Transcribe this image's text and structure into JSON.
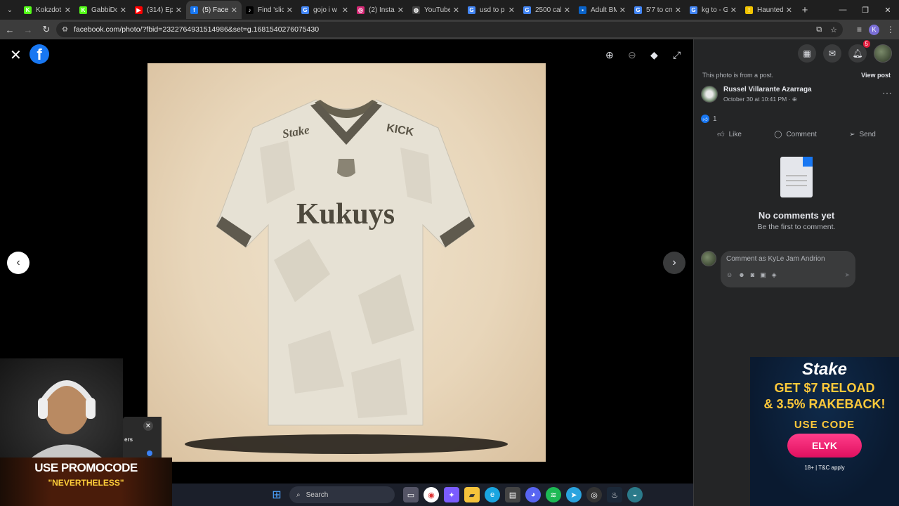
{
  "browser": {
    "tabs": [
      {
        "label": "Kokzdot",
        "color": "#53fc18",
        "glyph": "K",
        "active": false
      },
      {
        "label": "GabbiDo",
        "color": "#53fc18",
        "glyph": "K",
        "active": false
      },
      {
        "label": "(314) Ep",
        "color": "#ff0000",
        "glyph": "▶",
        "active": false
      },
      {
        "label": "(5) Faceb",
        "color": "#1877f2",
        "glyph": "f",
        "active": true
      },
      {
        "label": "Find 'slic",
        "color": "#000000",
        "glyph": "♪",
        "active": false
      },
      {
        "label": "gojo i w",
        "color": "#4285f4",
        "glyph": "G",
        "active": false
      },
      {
        "label": "(2) Insta",
        "color": "#d62976",
        "glyph": "◎",
        "active": false
      },
      {
        "label": "YouTube",
        "color": "#444444",
        "glyph": "◍",
        "active": false
      },
      {
        "label": "usd to p",
        "color": "#4285f4",
        "glyph": "G",
        "active": false
      },
      {
        "label": "2500 cal",
        "color": "#4285f4",
        "glyph": "G",
        "active": false
      },
      {
        "label": "Adult BM",
        "color": "#0a63c9",
        "glyph": "▪",
        "active": false
      },
      {
        "label": "5'7 to cm",
        "color": "#4285f4",
        "glyph": "G",
        "active": false
      },
      {
        "label": "kg to - G",
        "color": "#4285f4",
        "glyph": "G",
        "active": false
      },
      {
        "label": "Haunted",
        "color": "#f2c400",
        "glyph": "!",
        "active": false
      }
    ],
    "url": "facebook.com/photo/?fbid=2322764931514986&set=g.1681540276075430",
    "profile_initial": "K"
  },
  "viewer": {
    "photo_brand": "Stake",
    "photo_sponsor": "KICK",
    "photo_wordmark": "Kukuys"
  },
  "sidebar": {
    "notification_count": "5",
    "post_notice": "This photo is from a post.",
    "view_post": "View post",
    "author_name": "Russel Villarante Azarraga",
    "post_date": "October 30 at 10:41 PM · ⊕",
    "reaction_count": "1",
    "actions": {
      "like": "Like",
      "comment": "Comment",
      "send": "Send"
    },
    "no_comments_title": "No comments yet",
    "no_comments_sub": "Be the first to comment.",
    "comment_placeholder": "Comment as KyLe Jam Andrion"
  },
  "ad": {
    "brand": "Stake",
    "offer_line1": "GET $7 RELOAD",
    "offer_line2": "& 3.5% RAKEBACK!",
    "use_code": "USE CODE",
    "code": "ELYK",
    "terms": "18+ | T&C apply"
  },
  "stream_overlay": {
    "popup_text": "ers",
    "promo_line1": "USE PROMOCODE",
    "promo_line2": "\"NEVERTHELESS\""
  },
  "taskbar": {
    "search_label": "Search"
  }
}
